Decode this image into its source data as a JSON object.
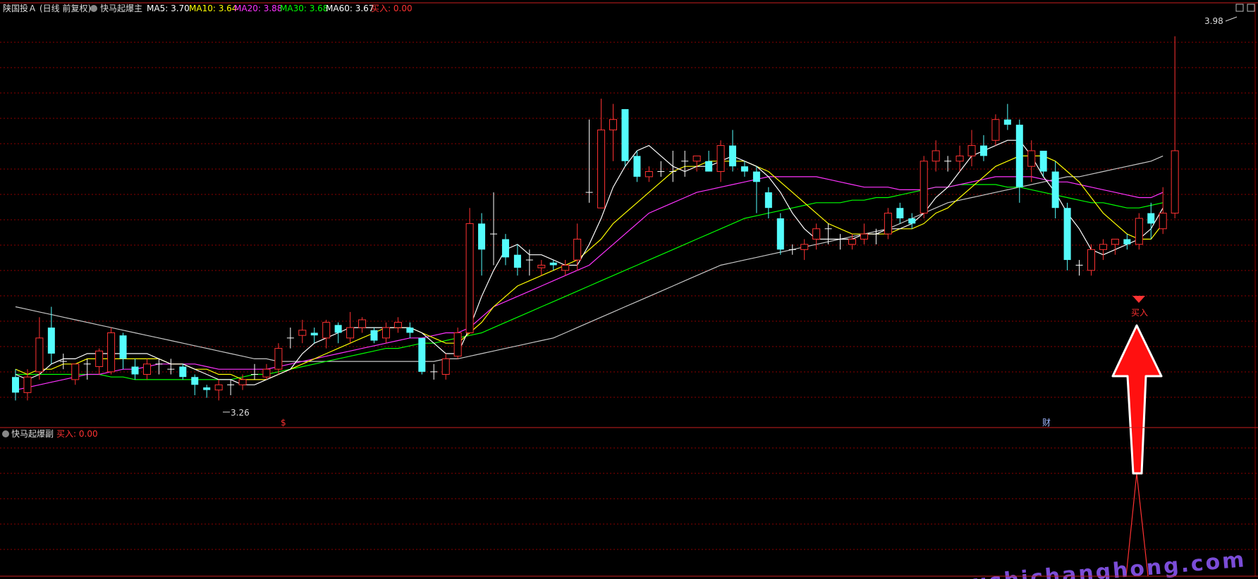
{
  "header": {
    "stock": "陕国投Ａ",
    "period": "(日线 前复权)",
    "indicator_main": "快马起爆主",
    "ma": [
      {
        "label": "MA5",
        "value": "3.70",
        "color": "#ffffff"
      },
      {
        "label": "MA10",
        "value": "3.64",
        "color": "#ffff00"
      },
      {
        "label": "MA20",
        "value": "3.88",
        "color": "#ff33ff"
      },
      {
        "label": "MA30",
        "value": "3.68",
        "color": "#00ff00"
      },
      {
        "label": "MA60",
        "value": "3.67",
        "color": "#ffffff"
      }
    ],
    "buy_label": "买入",
    "buy_value": "0.00"
  },
  "sub_header": {
    "indicator": "快马起爆副",
    "buy_label": "买入",
    "buy_value": "0.00"
  },
  "annotations": {
    "high": "3.98",
    "low": "3.26",
    "buy_text": "买入",
    "dollar": "$",
    "cai": "财"
  },
  "watermark": "www.gushichanghong.com",
  "colors": {
    "up": "#ff3232",
    "down": "#54fcfc",
    "doji": "#ffffff",
    "grid": "#8b0000",
    "ma5": "#ffffff",
    "ma10": "#ffff00",
    "ma20": "#ff33ff",
    "ma30": "#00ff00",
    "ma60": "#c8c8c8"
  },
  "chart_data": {
    "type": "candlestick",
    "ylim": [
      3.22,
      4.0
    ],
    "grid": true,
    "candles": [
      [
        3.305,
        3.275,
        3.32,
        3.26
      ],
      [
        3.275,
        3.305,
        3.32,
        3.26
      ],
      [
        3.315,
        3.38,
        3.42,
        3.3
      ],
      [
        3.4,
        3.35,
        3.44,
        3.33
      ],
      [
        3.335,
        3.335,
        3.35,
        3.32
      ],
      [
        3.3,
        3.33,
        3.33,
        3.29
      ],
      [
        3.33,
        3.33,
        3.34,
        3.3
      ],
      [
        3.325,
        3.355,
        3.36,
        3.31
      ],
      [
        3.315,
        3.39,
        3.4,
        3.31
      ],
      [
        3.385,
        3.34,
        3.39,
        3.32
      ],
      [
        3.325,
        3.31,
        3.34,
        3.3
      ],
      [
        3.31,
        3.33,
        3.34,
        3.3
      ],
      [
        3.33,
        3.33,
        3.34,
        3.31
      ],
      [
        3.32,
        3.32,
        3.34,
        3.31
      ],
      [
        3.325,
        3.305,
        3.33,
        3.3
      ],
      [
        3.305,
        3.29,
        3.31,
        3.27
      ],
      [
        3.285,
        3.28,
        3.29,
        3.265
      ],
      [
        3.28,
        3.29,
        3.3,
        3.26
      ],
      [
        3.29,
        3.29,
        3.3,
        3.27
      ],
      [
        3.29,
        3.3,
        3.31,
        3.28
      ],
      [
        3.31,
        3.31,
        3.33,
        3.3
      ],
      [
        3.305,
        3.32,
        3.33,
        3.3
      ],
      [
        3.32,
        3.36,
        3.37,
        3.31
      ],
      [
        3.38,
        3.38,
        3.4,
        3.36
      ],
      [
        3.385,
        3.395,
        3.415,
        3.37
      ],
      [
        3.39,
        3.385,
        3.4,
        3.37
      ],
      [
        3.38,
        3.41,
        3.415,
        3.36
      ],
      [
        3.405,
        3.39,
        3.41,
        3.37
      ],
      [
        3.38,
        3.4,
        3.43,
        3.37
      ],
      [
        3.4,
        3.415,
        3.42,
        3.39
      ],
      [
        3.395,
        3.375,
        3.4,
        3.37
      ],
      [
        3.38,
        3.4,
        3.41,
        3.37
      ],
      [
        3.4,
        3.41,
        3.42,
        3.39
      ],
      [
        3.4,
        3.39,
        3.41,
        3.38
      ],
      [
        3.38,
        3.315,
        3.38,
        3.31
      ],
      [
        3.315,
        3.315,
        3.33,
        3.3
      ],
      [
        3.31,
        3.34,
        3.35,
        3.3
      ],
      [
        3.345,
        3.39,
        3.4,
        3.34
      ],
      [
        3.39,
        3.6,
        3.63,
        3.39
      ],
      [
        3.6,
        3.55,
        3.62,
        3.5
      ],
      [
        3.58,
        3.58,
        3.66,
        3.52
      ],
      [
        3.57,
        3.535,
        3.58,
        3.52
      ],
      [
        3.54,
        3.515,
        3.56,
        3.5
      ],
      [
        3.53,
        3.53,
        3.55,
        3.5
      ],
      [
        3.515,
        3.52,
        3.53,
        3.5
      ],
      [
        3.525,
        3.52,
        3.53,
        3.51
      ],
      [
        3.51,
        3.52,
        3.53,
        3.5
      ],
      [
        3.53,
        3.57,
        3.6,
        3.51
      ],
      [
        3.66,
        3.66,
        3.8,
        3.64
      ],
      [
        3.63,
        3.78,
        3.84,
        3.63
      ],
      [
        3.78,
        3.8,
        3.83,
        3.72
      ],
      [
        3.82,
        3.72,
        3.82,
        3.71
      ],
      [
        3.73,
        3.69,
        3.74,
        3.68
      ],
      [
        3.69,
        3.7,
        3.71,
        3.68
      ],
      [
        3.7,
        3.7,
        3.72,
        3.69
      ],
      [
        3.7,
        3.7,
        3.74,
        3.68
      ],
      [
        3.72,
        3.72,
        3.74,
        3.69
      ],
      [
        3.72,
        3.73,
        3.73,
        3.7
      ],
      [
        3.72,
        3.7,
        3.74,
        3.7
      ],
      [
        3.7,
        3.75,
        3.76,
        3.68
      ],
      [
        3.75,
        3.71,
        3.78,
        3.7
      ],
      [
        3.71,
        3.7,
        3.72,
        3.69
      ],
      [
        3.7,
        3.68,
        3.71,
        3.62
      ],
      [
        3.66,
        3.63,
        3.67,
        3.61
      ],
      [
        3.61,
        3.55,
        3.62,
        3.54
      ],
      [
        3.55,
        3.55,
        3.56,
        3.54
      ],
      [
        3.55,
        3.56,
        3.57,
        3.53
      ],
      [
        3.57,
        3.59,
        3.6,
        3.55
      ],
      [
        3.59,
        3.59,
        3.6,
        3.56
      ],
      [
        3.57,
        3.57,
        3.58,
        3.55
      ],
      [
        3.56,
        3.57,
        3.58,
        3.55
      ],
      [
        3.57,
        3.58,
        3.6,
        3.56
      ],
      [
        3.58,
        3.58,
        3.59,
        3.56
      ],
      [
        3.58,
        3.62,
        3.63,
        3.57
      ],
      [
        3.63,
        3.61,
        3.64,
        3.6
      ],
      [
        3.61,
        3.6,
        3.62,
        3.59
      ],
      [
        3.62,
        3.72,
        3.73,
        3.61
      ],
      [
        3.72,
        3.74,
        3.76,
        3.7
      ],
      [
        3.72,
        3.72,
        3.73,
        3.7
      ],
      [
        3.72,
        3.73,
        3.75,
        3.7
      ],
      [
        3.73,
        3.75,
        3.78,
        3.71
      ],
      [
        3.75,
        3.73,
        3.77,
        3.72
      ],
      [
        3.76,
        3.8,
        3.81,
        3.75
      ],
      [
        3.8,
        3.79,
        3.83,
        3.78
      ],
      [
        3.79,
        3.67,
        3.8,
        3.64
      ],
      [
        3.71,
        3.74,
        3.76,
        3.68
      ],
      [
        3.74,
        3.7,
        3.74,
        3.69
      ],
      [
        3.7,
        3.63,
        3.72,
        3.61
      ],
      [
        3.63,
        3.53,
        3.64,
        3.51
      ],
      [
        3.52,
        3.52,
        3.53,
        3.5
      ],
      [
        3.51,
        3.55,
        3.56,
        3.5
      ],
      [
        3.55,
        3.56,
        3.57,
        3.53
      ],
      [
        3.56,
        3.57,
        3.57,
        3.54
      ],
      [
        3.57,
        3.56,
        3.58,
        3.55
      ],
      [
        3.56,
        3.61,
        3.62,
        3.55
      ],
      [
        3.62,
        3.6,
        3.64,
        3.57
      ],
      [
        3.59,
        3.62,
        3.67,
        3.58
      ],
      [
        3.62,
        3.74,
        3.96,
        3.61
      ]
    ],
    "ma5": [
      3.31,
      3.3,
      3.31,
      3.33,
      3.34,
      3.34,
      3.35,
      3.35,
      3.35,
      3.35,
      3.35,
      3.35,
      3.34,
      3.33,
      3.33,
      3.32,
      3.31,
      3.3,
      3.3,
      3.29,
      3.29,
      3.3,
      3.31,
      3.32,
      3.35,
      3.37,
      3.38,
      3.39,
      3.4,
      3.4,
      3.4,
      3.4,
      3.4,
      3.4,
      3.39,
      3.37,
      3.35,
      3.35,
      3.4,
      3.46,
      3.51,
      3.55,
      3.56,
      3.54,
      3.54,
      3.53,
      3.52,
      3.52,
      3.56,
      3.61,
      3.67,
      3.71,
      3.74,
      3.75,
      3.73,
      3.71,
      3.7,
      3.71,
      3.71,
      3.72,
      3.73,
      3.72,
      3.71,
      3.69,
      3.66,
      3.62,
      3.59,
      3.57,
      3.57,
      3.57,
      3.57,
      3.58,
      3.58,
      3.59,
      3.59,
      3.6,
      3.62,
      3.65,
      3.67,
      3.7,
      3.73,
      3.74,
      3.75,
      3.76,
      3.76,
      3.73,
      3.69,
      3.66,
      3.62,
      3.59,
      3.55,
      3.54,
      3.55,
      3.56,
      3.57,
      3.59,
      3.63
    ],
    "ma10": [
      3.32,
      3.31,
      3.32,
      3.32,
      3.33,
      3.33,
      3.34,
      3.34,
      3.34,
      3.34,
      3.34,
      3.34,
      3.34,
      3.33,
      3.33,
      3.32,
      3.32,
      3.31,
      3.31,
      3.3,
      3.3,
      3.3,
      3.31,
      3.32,
      3.33,
      3.34,
      3.35,
      3.36,
      3.37,
      3.38,
      3.39,
      3.4,
      3.4,
      3.4,
      3.39,
      3.38,
      3.37,
      3.37,
      3.39,
      3.41,
      3.44,
      3.46,
      3.48,
      3.49,
      3.5,
      3.51,
      3.52,
      3.53,
      3.55,
      3.57,
      3.6,
      3.62,
      3.64,
      3.66,
      3.68,
      3.7,
      3.71,
      3.71,
      3.72,
      3.72,
      3.72,
      3.72,
      3.71,
      3.7,
      3.68,
      3.66,
      3.64,
      3.62,
      3.6,
      3.59,
      3.58,
      3.58,
      3.58,
      3.58,
      3.59,
      3.59,
      3.6,
      3.62,
      3.63,
      3.65,
      3.67,
      3.69,
      3.71,
      3.72,
      3.73,
      3.73,
      3.73,
      3.72,
      3.7,
      3.68,
      3.65,
      3.62,
      3.6,
      3.58,
      3.57,
      3.57,
      3.6
    ],
    "ma20": [
      3.28,
      3.285,
      3.29,
      3.295,
      3.3,
      3.305,
      3.31,
      3.31,
      3.315,
      3.32,
      3.32,
      3.325,
      3.33,
      3.33,
      3.33,
      3.33,
      3.325,
      3.32,
      3.32,
      3.32,
      3.32,
      3.32,
      3.325,
      3.33,
      3.335,
      3.34,
      3.345,
      3.35,
      3.355,
      3.36,
      3.365,
      3.37,
      3.375,
      3.38,
      3.38,
      3.385,
      3.39,
      3.39,
      3.4,
      3.42,
      3.44,
      3.45,
      3.46,
      3.47,
      3.48,
      3.49,
      3.5,
      3.51,
      3.52,
      3.54,
      3.56,
      3.58,
      3.6,
      3.62,
      3.63,
      3.64,
      3.65,
      3.66,
      3.665,
      3.67,
      3.675,
      3.68,
      3.685,
      3.69,
      3.69,
      3.69,
      3.69,
      3.69,
      3.685,
      3.68,
      3.675,
      3.67,
      3.67,
      3.67,
      3.665,
      3.665,
      3.665,
      3.67,
      3.67,
      3.675,
      3.68,
      3.685,
      3.69,
      3.69,
      3.69,
      3.69,
      3.685,
      3.68,
      3.68,
      3.675,
      3.67,
      3.665,
      3.66,
      3.655,
      3.65,
      3.65,
      3.66
    ],
    "ma30": [
      3.31,
      3.31,
      3.31,
      3.31,
      3.31,
      3.31,
      3.31,
      3.31,
      3.305,
      3.305,
      3.3,
      3.3,
      3.3,
      3.3,
      3.3,
      3.3,
      3.3,
      3.3,
      3.3,
      3.305,
      3.31,
      3.31,
      3.315,
      3.32,
      3.325,
      3.33,
      3.335,
      3.34,
      3.345,
      3.35,
      3.355,
      3.36,
      3.36,
      3.365,
      3.37,
      3.37,
      3.375,
      3.38,
      3.385,
      3.39,
      3.4,
      3.41,
      3.42,
      3.43,
      3.44,
      3.45,
      3.46,
      3.47,
      3.48,
      3.49,
      3.5,
      3.51,
      3.52,
      3.53,
      3.54,
      3.55,
      3.56,
      3.57,
      3.58,
      3.59,
      3.6,
      3.61,
      3.615,
      3.62,
      3.625,
      3.63,
      3.635,
      3.64,
      3.64,
      3.64,
      3.645,
      3.645,
      3.65,
      3.65,
      3.655,
      3.66,
      3.665,
      3.67,
      3.67,
      3.675,
      3.675,
      3.675,
      3.675,
      3.67,
      3.67,
      3.665,
      3.66,
      3.655,
      3.65,
      3.645,
      3.64,
      3.64,
      3.635,
      3.63,
      3.63,
      3.635,
      3.64
    ],
    "ma60": [
      3.44,
      3.435,
      3.43,
      3.425,
      3.42,
      3.415,
      3.41,
      3.405,
      3.4,
      3.395,
      3.39,
      3.385,
      3.38,
      3.375,
      3.37,
      3.365,
      3.36,
      3.355,
      3.35,
      3.345,
      3.34,
      3.34,
      3.335,
      3.335,
      3.335,
      3.335,
      3.335,
      3.335,
      3.335,
      3.335,
      3.335,
      3.335,
      3.335,
      3.335,
      3.335,
      3.335,
      3.34,
      3.34,
      3.345,
      3.35,
      3.355,
      3.36,
      3.365,
      3.37,
      3.375,
      3.38,
      3.39,
      3.4,
      3.41,
      3.42,
      3.43,
      3.44,
      3.45,
      3.46,
      3.47,
      3.48,
      3.49,
      3.5,
      3.51,
      3.52,
      3.525,
      3.53,
      3.535,
      3.54,
      3.545,
      3.55,
      3.555,
      3.56,
      3.565,
      3.57,
      3.575,
      3.58,
      3.585,
      3.59,
      3.6,
      3.61,
      3.62,
      3.63,
      3.64,
      3.645,
      3.65,
      3.655,
      3.66,
      3.665,
      3.67,
      3.675,
      3.68,
      3.685,
      3.69,
      3.69,
      3.695,
      3.7,
      3.705,
      3.71,
      3.715,
      3.72,
      3.73
    ]
  }
}
